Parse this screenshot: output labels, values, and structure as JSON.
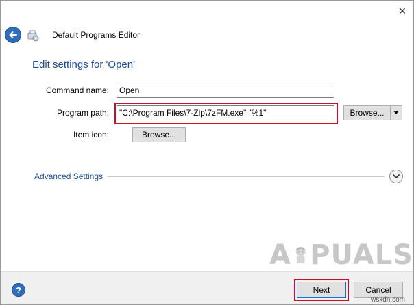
{
  "window": {
    "title": "Default Programs Editor",
    "close_glyph": "✕"
  },
  "page": {
    "heading": "Edit settings for 'Open'"
  },
  "form": {
    "command_name_label": "Command name:",
    "command_name_value": "Open",
    "program_path_label": "Program path:",
    "program_path_value": "\"C:\\Program Files\\7-Zip\\7zFM.exe\" \"%1\"",
    "browse_label": "Browse...",
    "item_icon_label": "Item icon:",
    "icon_browse_label": "Browse..."
  },
  "advanced": {
    "label": "Advanced Settings"
  },
  "footer": {
    "help_glyph": "?",
    "next_label": "Next",
    "cancel_label": "Cancel"
  },
  "watermark": {
    "text": "APPUALS",
    "site": "wsxdn.com"
  },
  "colors": {
    "accent": "#1e4e8c",
    "highlight": "#c8102e"
  }
}
